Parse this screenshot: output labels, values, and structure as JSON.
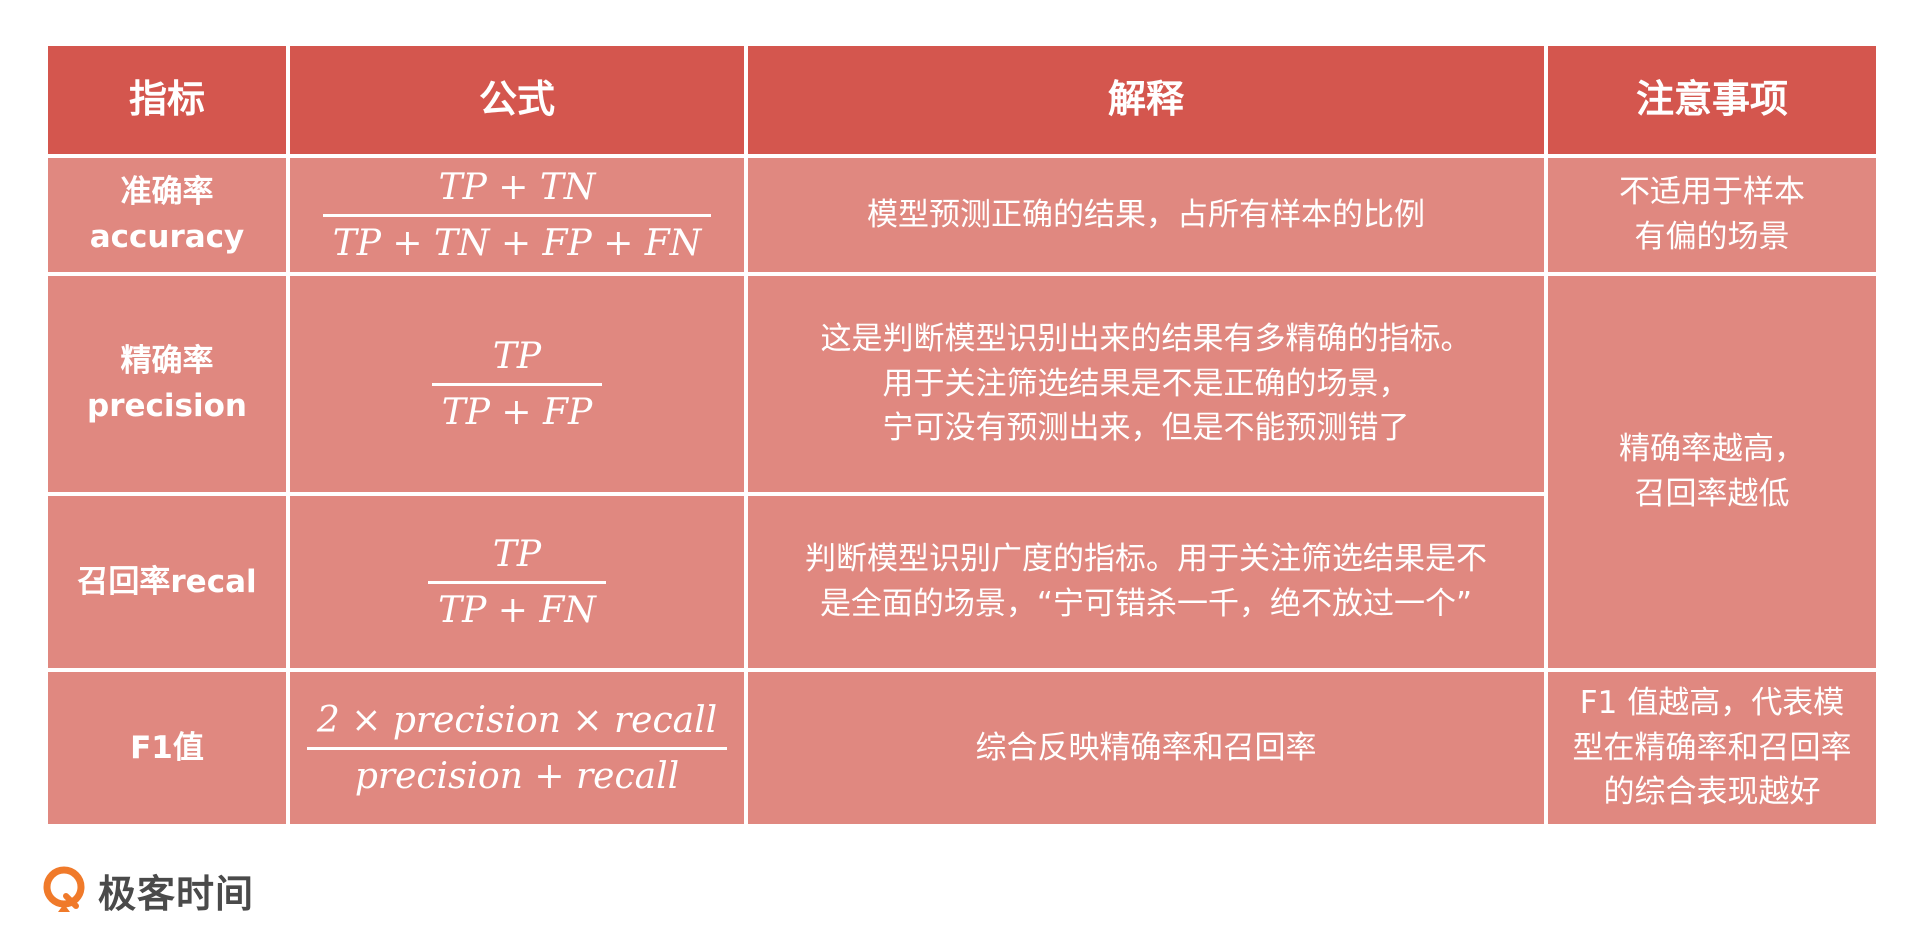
{
  "table": {
    "headers": [
      "指标",
      "公式",
      "解释",
      "注意事项"
    ],
    "rows": {
      "accuracy": {
        "name": "准确率",
        "name_en": "accuracy",
        "formula_numerator": "TP + TN",
        "formula_denominator": "TP + TN + FP + FN",
        "explanation": [
          "模型预测正确的结果，占所有样本的比例"
        ],
        "notes": [
          "不适用于样本",
          "有偏的场景"
        ]
      },
      "precision": {
        "name": "精确率",
        "name_en": "precision",
        "formula_numerator": "TP",
        "formula_denominator": "TP + FP",
        "explanation": [
          "这是判断模型识别出来的结果有多精确的指标。",
          "用于关注筛选结果是不是正确的场景，",
          "宁可没有预测出来，但是不能预测错了"
        ]
      },
      "recall": {
        "name": "召回率recal",
        "formula_numerator": "TP",
        "formula_denominator": "TP + FN",
        "explanation": [
          "判断模型识别广度的指标。用于关注筛选结果是不",
          "是全面的场景，“宁可错杀一千，绝不放过一个”"
        ]
      },
      "precision_recall_notes": [
        "精确率越高，",
        "召回率越低"
      ],
      "f1": {
        "name": "F1值",
        "formula_numerator": "2 × precision × recall",
        "formula_denominator": "precision + recall",
        "explanation": [
          "综合反映精确率和召回率"
        ],
        "notes": [
          "F1 值越高，代表模",
          "型在精确率和召回率",
          "的综合表现越好"
        ]
      }
    }
  },
  "brand": {
    "name": "极客时间",
    "logo_icon": "geektime-logo-icon"
  },
  "colors": {
    "header_bg": "#d4564e",
    "cell_bg": "#e08880",
    "text": "#ffffff",
    "logo_orange": "#f07a2a"
  }
}
